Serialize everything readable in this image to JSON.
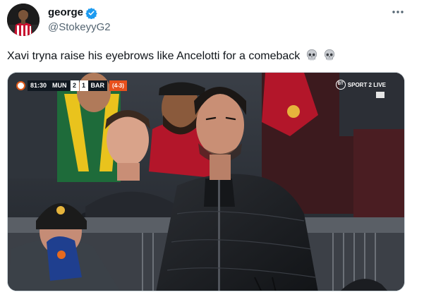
{
  "user": {
    "display_name": "george",
    "handle": "@StokeyyG2",
    "verified": true
  },
  "tweet": {
    "text": "Xavi tryna raise his eyebrows like Ancelotti for a comeback",
    "emojis": [
      "skull-icon",
      "skull-icon"
    ]
  },
  "media": {
    "scorebug": {
      "time": "81:30",
      "home": "MUN",
      "home_score": "2",
      "away_score": "1",
      "away": "BAR",
      "aggregate": "(4-3)"
    },
    "broadcaster": {
      "logo": "BT",
      "channel": "SPORT 2 LIVE"
    }
  },
  "colors": {
    "text": "#0f1419",
    "secondary": "#536471",
    "verified": "#1d9bf0",
    "border": "#cfd9de",
    "aggregate": "#e8501c"
  }
}
